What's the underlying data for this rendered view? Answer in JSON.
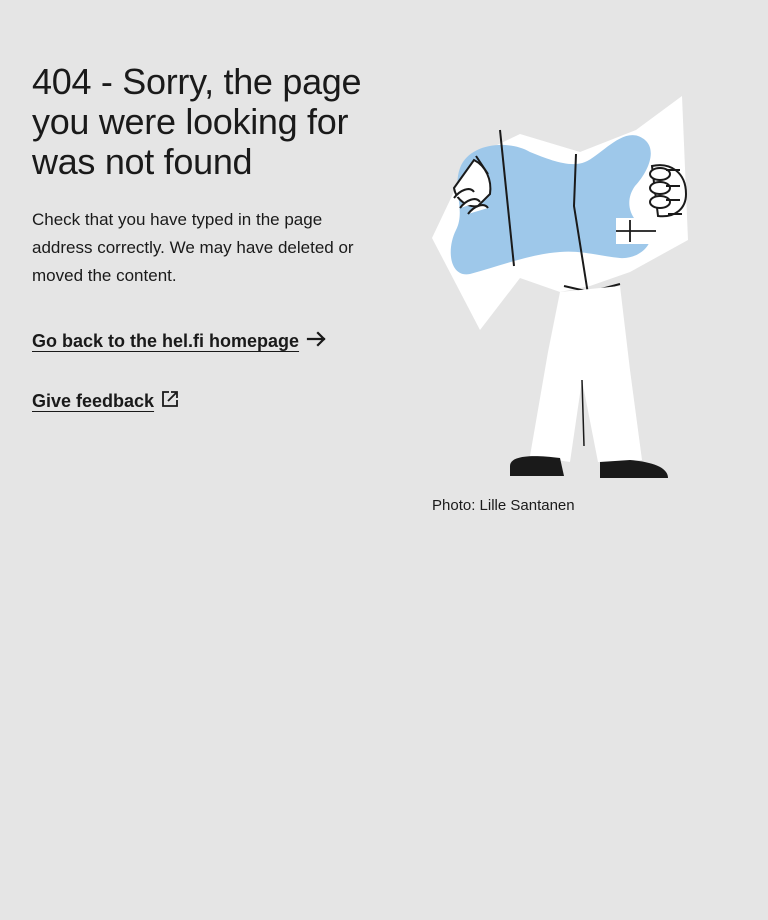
{
  "error": {
    "title": "404 - Sorry, the page you were looking for was not found",
    "description": "Check that you have typed in the page address correctly. We may have deleted or moved the content."
  },
  "links": {
    "homepage_label": "Go back to the hel.fi homepage",
    "homepage_icon": "arrow-right-icon",
    "feedback_label": "Give feedback",
    "feedback_icon": "external-link-icon"
  },
  "illustration": {
    "caption": "Photo: Lille Santanen",
    "map_color": "#9ec8ea"
  }
}
